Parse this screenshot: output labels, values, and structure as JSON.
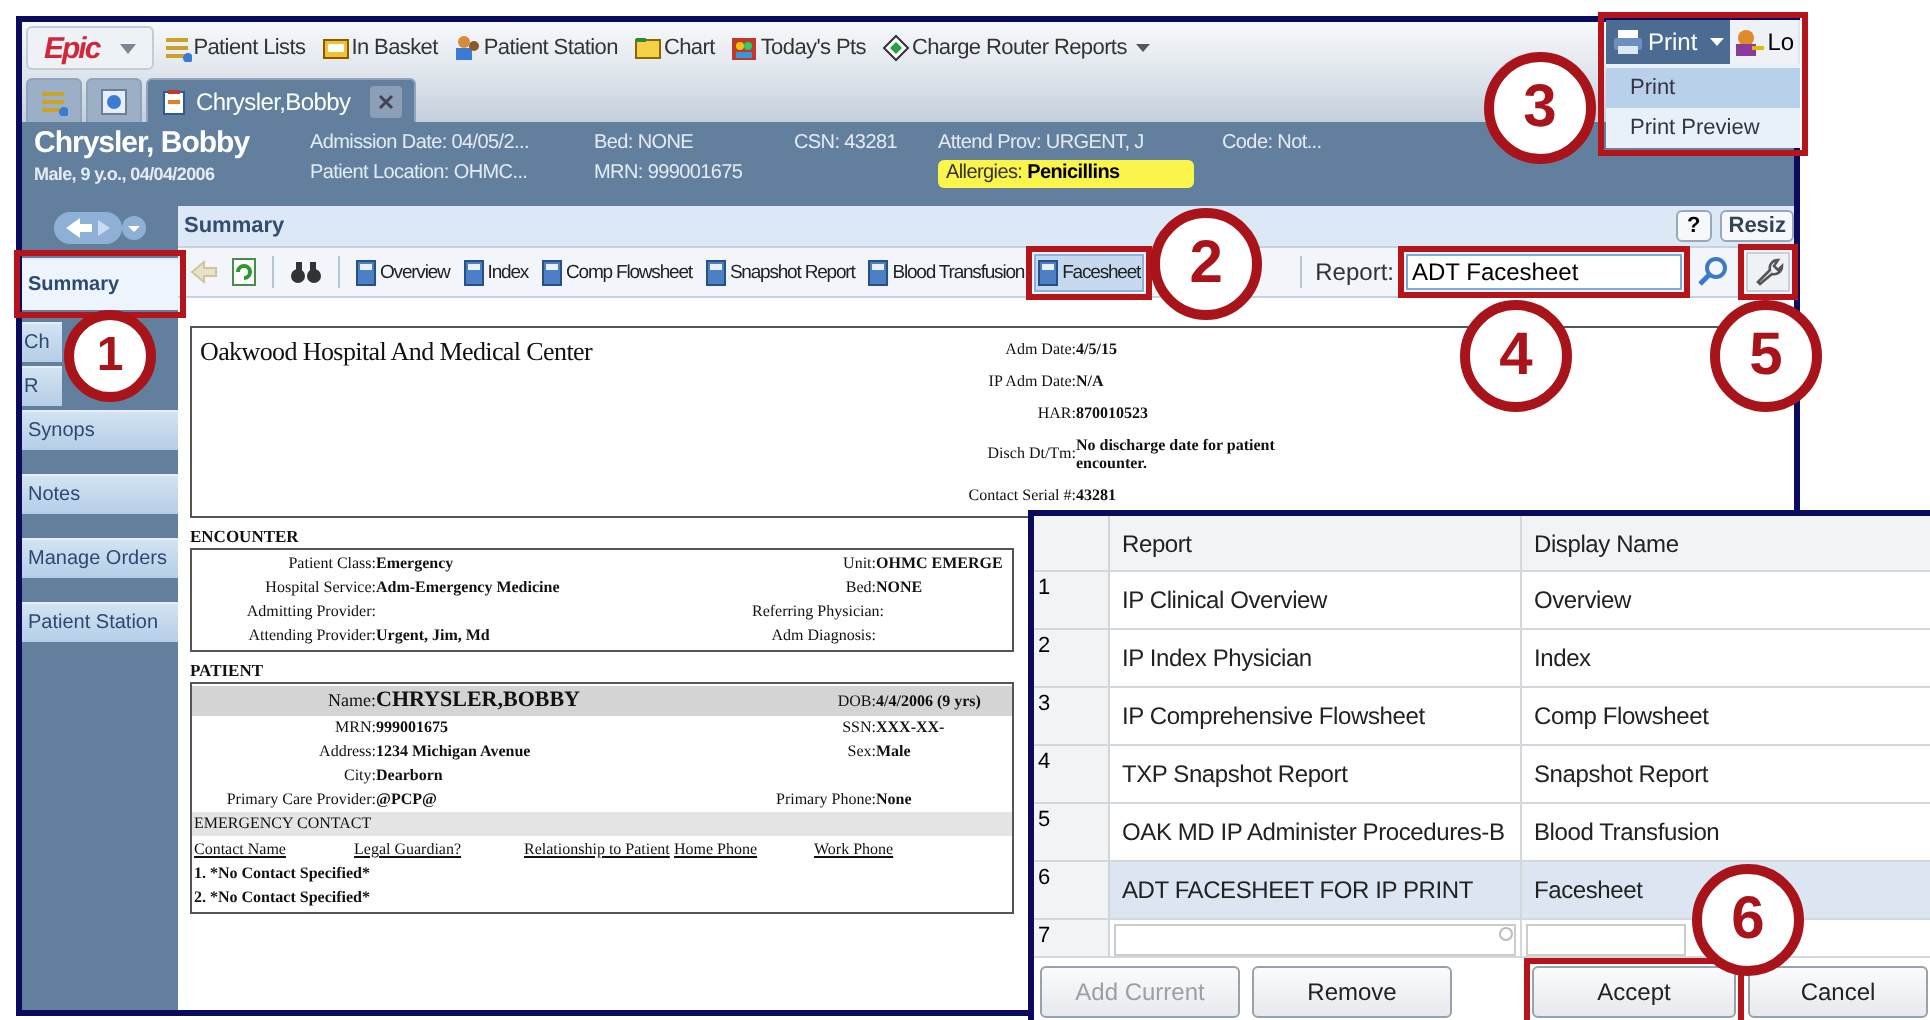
{
  "top_menu": {
    "logo": "Epic",
    "items": [
      {
        "label": "Patient Lists",
        "kind": "lists",
        "dropdown": false
      },
      {
        "label": "In Basket",
        "kind": "inbox",
        "dropdown": false
      },
      {
        "label": "Patient Station",
        "kind": "station",
        "dropdown": false
      },
      {
        "label": "Chart",
        "kind": "chart",
        "dropdown": false
      },
      {
        "label": "Today's Pts",
        "kind": "people",
        "dropdown": false
      },
      {
        "label": "Charge Router Reports",
        "kind": "diamond",
        "dropdown": true
      }
    ]
  },
  "workspace_tabs": [
    {
      "kind": "lists",
      "selected": false
    },
    {
      "kind": "clock",
      "selected": false
    },
    {
      "kind": "patient",
      "label": "Chrysler,Bobby",
      "selected": true
    }
  ],
  "print_button": {
    "label": "Print"
  },
  "log_button": {
    "label": "Lo"
  },
  "print_menu": [
    {
      "label": "Print",
      "selected": true
    },
    {
      "label": "Print Preview",
      "selected": false
    }
  ],
  "patient_header": {
    "name": "Chrysler, Bobby",
    "details": "Male, 9 y.o., 04/04/2006",
    "columns": [
      [
        "Admission Date: 04/05/2...",
        "Patient Location: OHMC..."
      ],
      [
        "Bed: NONE",
        "MRN: 999001675"
      ],
      [
        "CSN: 43281"
      ],
      [
        "Attend Prov: URGENT, J"
      ],
      [
        "Code: Not..."
      ]
    ],
    "allergies": {
      "label": "Allergies:",
      "value": "Penicillins"
    }
  },
  "sidebar": {
    "groups": [
      {
        "items": [
          {
            "label": "Summary",
            "selected": true
          },
          {
            "label": "Ch",
            "selected": false
          },
          {
            "label": "R",
            "selected": false
          },
          {
            "label": "Synops",
            "selected": false
          }
        ]
      },
      {
        "items": [
          {
            "label": "Notes",
            "selected": false
          }
        ]
      },
      {
        "items": [
          {
            "label": "Manage Orders",
            "selected": false
          }
        ]
      },
      {
        "items": [
          {
            "label": "Patient Station",
            "selected": false
          }
        ]
      }
    ]
  },
  "activity": {
    "title": "Summary",
    "help": "?",
    "resize": "Resiz"
  },
  "toolbar": {
    "reports": [
      {
        "label": "Overview",
        "selected": false
      },
      {
        "label": "Index",
        "selected": false
      },
      {
        "label": "Comp Flowsheet",
        "selected": false
      },
      {
        "label": "Snapshot Report",
        "selected": false
      },
      {
        "label": "Blood Transfusion",
        "selected": false
      },
      {
        "label": "Facesheet",
        "selected": true
      }
    ],
    "report_label": "Report:",
    "report_value": "ADT Facesheet"
  },
  "document": {
    "hospital": "Oakwood Hospital And Medical Center",
    "header_fields": [
      {
        "label": "Adm Date:",
        "value": "4/5/15"
      },
      {
        "label": "IP Adm Date:",
        "value": "N/A"
      },
      {
        "label": "HAR:",
        "value": "870010523"
      },
      {
        "label": "Disch Dt/Tm:",
        "value": "No discharge date for patient encounter."
      },
      {
        "label": "Contact Serial #:",
        "value": "43281"
      }
    ],
    "sections": [
      {
        "title": "ENCOUNTER",
        "rows": [
          {
            "highlighted": false,
            "left": {
              "label": "Patient Class:",
              "value": "Emergency"
            },
            "right": {
              "label": "Unit:",
              "value": "OHMC EMERGE"
            }
          },
          {
            "highlighted": false,
            "left": {
              "label": "Hospital Service:",
              "value": "Adm-Emergency Medicine"
            },
            "right": {
              "label": "Bed:",
              "value": "NONE"
            }
          },
          {
            "highlighted": false,
            "left": {
              "label": "Admitting Provider:"
            },
            "right": {
              "label": "Referring Physician:"
            }
          },
          {
            "highlighted": false,
            "left": {
              "label": "Attending Provider:",
              "value": "Urgent, Jim, Md"
            },
            "right": {
              "label": "Adm Diagnosis:"
            }
          }
        ]
      },
      {
        "title": "PATIENT",
        "rows": [
          {
            "highlighted": true,
            "left": {
              "label": "Name:",
              "value": "CHRYSLER,BOBBY"
            },
            "right": {
              "label": "DOB:",
              "value": "4/4/2006 (9 yrs)"
            }
          },
          {
            "highlighted": false,
            "left": {
              "label": "MRN:",
              "value": "999001675"
            },
            "right": {
              "label": "SSN:",
              "value": "XXX-XX-"
            }
          },
          {
            "highlighted": false,
            "left": {
              "label": "Address:",
              "value": "1234 Michigan Avenue"
            },
            "right": {
              "label": "Sex:",
              "value": "Male"
            }
          },
          {
            "highlighted": false,
            "left": {
              "label": "City:",
              "value": "Dearborn"
            }
          },
          {
            "highlighted": false,
            "left": {
              "label": "Primary Care Provider:",
              "value": "@PCP@"
            },
            "right": {
              "label": "Primary Phone:",
              "value": "None"
            }
          }
        ]
      }
    ],
    "emergency_contact": {
      "title": "EMERGENCY CONTACT",
      "columns": [
        "Contact Name",
        "Legal Guardian?",
        "Relationship to Patient",
        "Home Phone",
        "Work Phone"
      ],
      "rows": [
        "1. *No Contact Specified*",
        "2. *No Contact Specified*"
      ]
    }
  },
  "report_dialog": {
    "columns": [
      "Report",
      "Display Name"
    ],
    "rows": [
      {
        "kind": "entry",
        "number": "1",
        "report": "IP Clinical Overview",
        "display_name": "Overview",
        "selected": false
      },
      {
        "kind": "entry",
        "number": "2",
        "report": "IP Index Physician",
        "display_name": "Index",
        "selected": false
      },
      {
        "kind": "entry",
        "number": "3",
        "report": "IP Comprehensive Flowsheet",
        "display_name": "Comp Flowsheet",
        "selected": false
      },
      {
        "kind": "entry",
        "number": "4",
        "report": "TXP Snapshot Report",
        "display_name": "Snapshot Report",
        "selected": false
      },
      {
        "kind": "entry",
        "number": "5",
        "report": "OAK MD IP Administer Procedures-B",
        "display_name": "Blood Transfusion",
        "selected": false
      },
      {
        "kind": "entry",
        "number": "6",
        "report": "ADT FACESHEET FOR IP PRINT",
        "display_name": "Facesheet",
        "selected": true
      },
      {
        "kind": "new",
        "number": "7",
        "selected": false
      }
    ],
    "buttons": [
      {
        "label": "Add Current",
        "disabled": true
      },
      {
        "label": "Remove",
        "disabled": false
      },
      {
        "label": "Accept",
        "disabled": false
      },
      {
        "label": "Cancel",
        "disabled": false
      }
    ]
  },
  "callouts": [
    {
      "number": "1"
    },
    {
      "number": "2"
    },
    {
      "number": "3"
    },
    {
      "number": "4"
    },
    {
      "number": "5"
    },
    {
      "number": "6"
    }
  ]
}
